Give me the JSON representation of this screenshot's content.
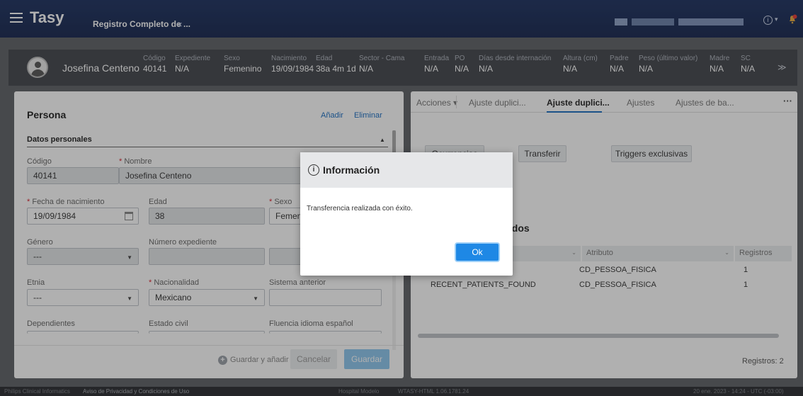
{
  "app": {
    "title": "Tasy",
    "tab_label": "Registro Completo de ...",
    "tab_close": "×"
  },
  "patient": {
    "name": "Josefina Centeno",
    "fields": [
      {
        "label": "Código",
        "value": "40141"
      },
      {
        "label": "Expediente",
        "value": "N/A"
      },
      {
        "label": "Sexo",
        "value": "Femenino"
      },
      {
        "label": "Nacimiento",
        "value": "19/09/1984"
      },
      {
        "label": "Edad",
        "value": "38a 4m 1d"
      },
      {
        "label": "Sector - Cama",
        "value": "N/A"
      },
      {
        "label": "Entrada",
        "value": "N/A"
      },
      {
        "label": "PO",
        "value": "N/A"
      },
      {
        "label": "Días desde internación",
        "value": "N/A"
      },
      {
        "label": "Altura (cm)",
        "value": "N/A"
      },
      {
        "label": "Padre",
        "value": "N/A"
      },
      {
        "label": "Peso (último valor)",
        "value": "N/A"
      },
      {
        "label": "Madre",
        "value": "N/A"
      },
      {
        "label": "SC",
        "value": "N/A"
      }
    ]
  },
  "persona": {
    "title": "Persona",
    "add": "Añadir",
    "delete": "Eliminar",
    "section": "Datos personales",
    "codigo_label": "Código",
    "codigo_value": "40141",
    "nombre_label": "Nombre",
    "nombre_value": "Josefina Centeno",
    "fecha_label": "Fecha de nacimiento",
    "fecha_value": "19/09/1984",
    "edad_label": "Edad",
    "edad_value": "38",
    "sexo_label": "Sexo",
    "sexo_value": "Femenino",
    "genero_label": "Género",
    "genero_value": "---",
    "expediente_label": "Número expediente",
    "etnia_label": "Etnia",
    "etnia_value": "---",
    "nacionalidad_label": "Nacionalidad",
    "nacionalidad_value": "Mexicano",
    "sistema_label": "Sistema anterior",
    "dependientes_label": "Dependientes",
    "estado_label": "Estado civil",
    "fluencia_label": "Fluencia idioma español",
    "save_add": "Guardar y añadir otro",
    "cancel": "Cancelar",
    "save": "Guardar"
  },
  "right": {
    "tabs": [
      "Acciones",
      "Ajuste duplici...",
      "Ajuste duplici...",
      "Ajustes",
      "Ajustes de ba..."
    ],
    "more": "···",
    "buttons": [
      "Ocurrencias",
      "Transferir",
      "Triggers exclusivas"
    ],
    "section": "zados",
    "headers": [
      "Atributo",
      "Registros"
    ],
    "rows": [
      {
        "name": "",
        "attr": "CD_PESSOA_FISICA",
        "count": "1"
      },
      {
        "name": "RECENT_PATIENTS_FOUND",
        "attr": "CD_PESSOA_FISICA",
        "count": "1"
      }
    ],
    "records": "Registros: 2"
  },
  "modal": {
    "title": "Información",
    "message": "Transferencia realizada con éxito.",
    "ok": "Ok"
  },
  "status": {
    "left": "Philips Clinical Informatics",
    "privacy": "Aviso de Privacidad y Condiciones de Uso",
    "hospital": "Hospital Modelo",
    "version": "WTASY-HTML 1.06.1781.24",
    "datetime": "20 ene. 2023 - 14:24 - UTC (-03:00)"
  },
  "colors": {
    "topbar": "#1d3160",
    "primary": "#1e88e5",
    "required": "#d9232e"
  }
}
